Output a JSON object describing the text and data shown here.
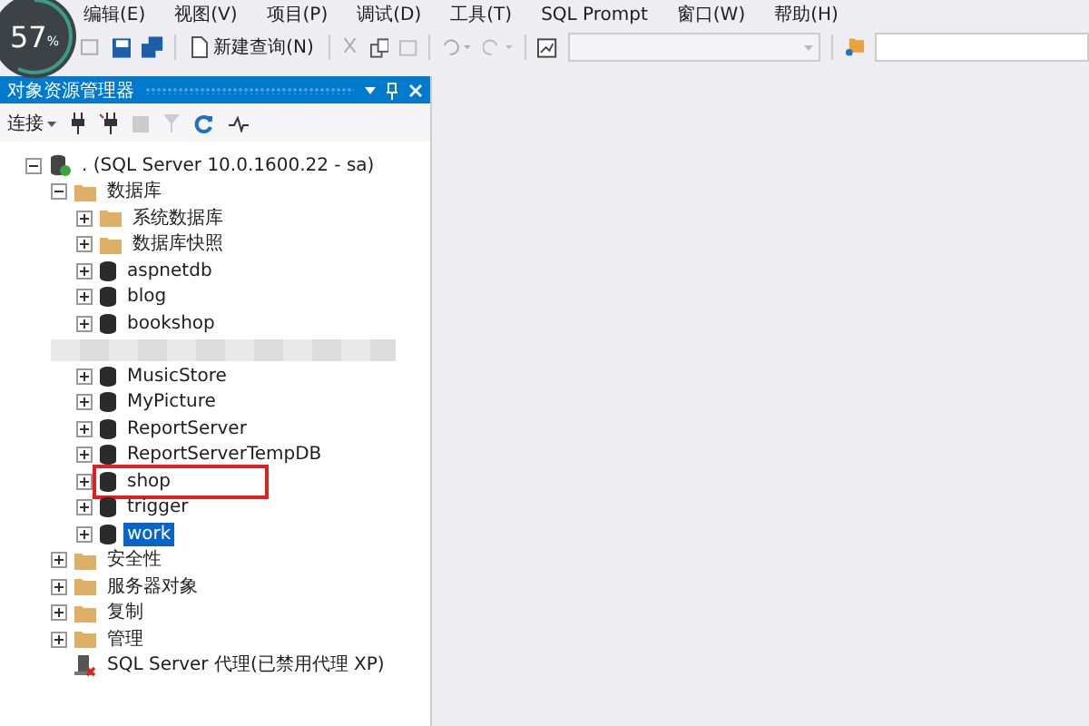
{
  "menu": [
    {
      "label": "编辑(E)"
    },
    {
      "label": "视图(V)"
    },
    {
      "label": "项目(P)"
    },
    {
      "label": "调试(D)"
    },
    {
      "label": "工具(T)"
    },
    {
      "label": "SQL Prompt"
    },
    {
      "label": "窗口(W)"
    },
    {
      "label": "帮助(H)"
    }
  ],
  "toolbar": {
    "new_query": "新建查询(N)"
  },
  "badge": {
    "value": "57",
    "unit": "%"
  },
  "panel": {
    "title": "对象资源管理器",
    "connect": "连接"
  },
  "tree": [
    {
      "kind": "server",
      "label": ". (SQL Server 10.0.1600.22 - sa)",
      "expanded": true,
      "selected": false,
      "highlighted": false,
      "children": [
        {
          "kind": "folder",
          "label": "数据库",
          "expanded": true,
          "selected": false,
          "highlighted": false,
          "children": [
            {
              "kind": "folder",
              "label": "系统数据库",
              "expanded": false,
              "selected": false,
              "highlighted": false
            },
            {
              "kind": "folder",
              "label": "数据库快照",
              "expanded": false,
              "selected": false,
              "highlighted": false
            },
            {
              "kind": "database",
              "label": "aspnetdb",
              "expanded": false,
              "selected": false,
              "highlighted": false
            },
            {
              "kind": "database",
              "label": "blog",
              "expanded": false,
              "selected": false,
              "highlighted": false
            },
            {
              "kind": "database",
              "label": "bookshop",
              "expanded": false,
              "selected": false,
              "highlighted": false
            },
            {
              "kind": "redacted"
            },
            {
              "kind": "database",
              "label": "MusicStore",
              "expanded": false,
              "selected": false,
              "highlighted": false
            },
            {
              "kind": "database",
              "label": "MyPicture",
              "expanded": false,
              "selected": false,
              "highlighted": false
            },
            {
              "kind": "database",
              "label": "ReportServer",
              "expanded": false,
              "selected": false,
              "highlighted": false
            },
            {
              "kind": "database",
              "label": "ReportServerTempDB",
              "expanded": false,
              "selected": false,
              "highlighted": false
            },
            {
              "kind": "database",
              "label": "shop",
              "expanded": false,
              "selected": false,
              "highlighted": true
            },
            {
              "kind": "database",
              "label": "trigger",
              "expanded": false,
              "selected": false,
              "highlighted": false
            },
            {
              "kind": "database",
              "label": "work",
              "expanded": false,
              "selected": true,
              "highlighted": false
            }
          ]
        },
        {
          "kind": "folder",
          "label": "安全性",
          "expanded": false,
          "selected": false,
          "highlighted": false
        },
        {
          "kind": "folder",
          "label": "服务器对象",
          "expanded": false,
          "selected": false,
          "highlighted": false
        },
        {
          "kind": "folder",
          "label": "复制",
          "expanded": false,
          "selected": false,
          "highlighted": false
        },
        {
          "kind": "folder",
          "label": "管理",
          "expanded": false,
          "selected": false,
          "highlighted": false
        },
        {
          "kind": "agent",
          "label": "SQL Server 代理(已禁用代理 XP)"
        }
      ]
    }
  ]
}
